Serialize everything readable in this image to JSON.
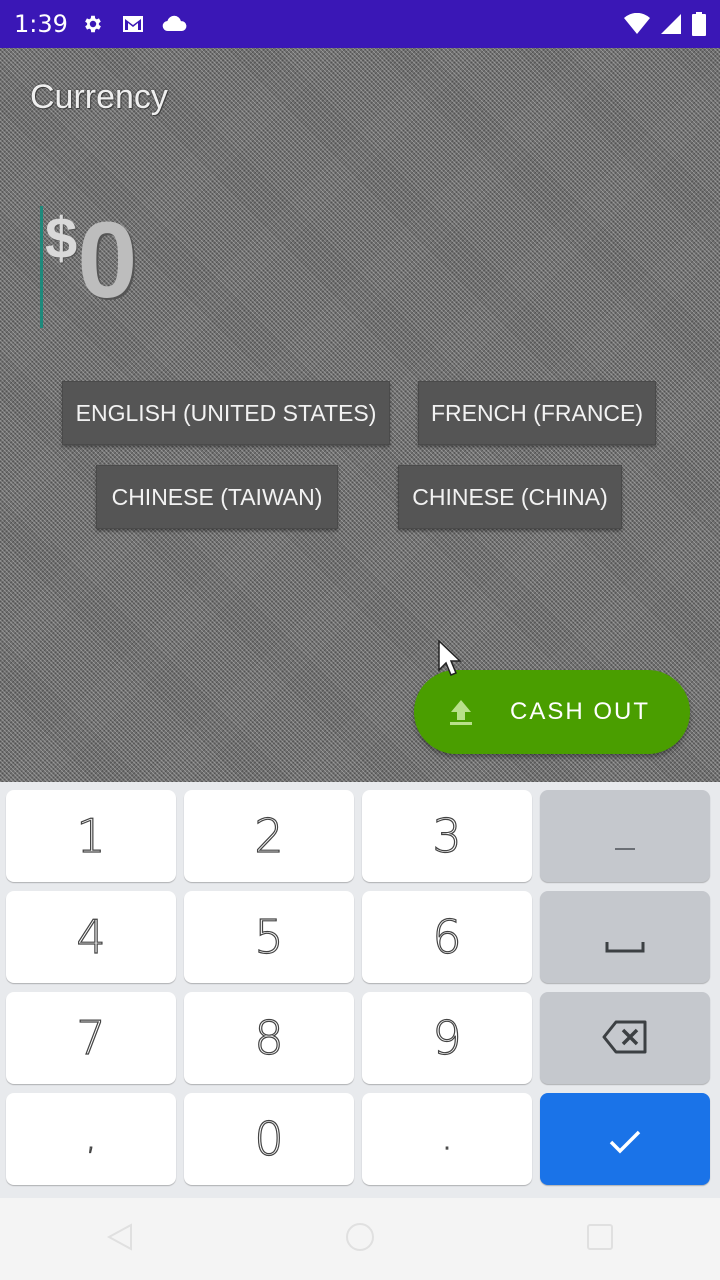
{
  "status_bar": {
    "time": "1:39",
    "icons_left": [
      "gear-icon",
      "mail-icon",
      "cloud-icon"
    ],
    "icons_right": [
      "wifi-icon",
      "signal-icon",
      "battery-icon"
    ],
    "color": "#3a17b6"
  },
  "screen": {
    "label": "Currency",
    "amount_symbol": "$",
    "amount_value": "0"
  },
  "locale_buttons": [
    {
      "label": "ENGLISH (UNITED STATES)"
    },
    {
      "label": "FRENCH (FRANCE)"
    },
    {
      "label": "CHINESE (TAIWAN)"
    },
    {
      "label": "CHINESE (CHINA)"
    }
  ],
  "cash_out": {
    "label": "CASH OUT",
    "icon": "upload-icon",
    "color": "#4a9e00"
  },
  "keyboard": {
    "keys": [
      "1",
      "2",
      "3",
      "−",
      "4",
      "5",
      "6",
      "␣",
      "7",
      "8",
      "9",
      "⌫",
      ",",
      "0",
      ".",
      "✓"
    ],
    "accent": "#1a73e8"
  },
  "nav_bar": {
    "icons": [
      "back-icon",
      "home-icon",
      "recents-icon"
    ]
  }
}
